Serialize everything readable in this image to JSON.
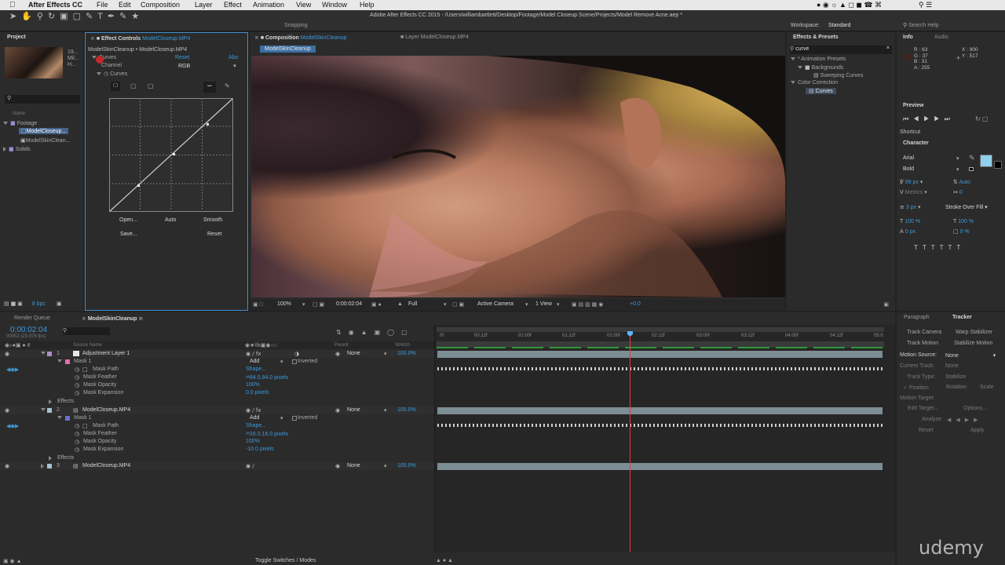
{
  "menubar": {
    "app": "After Effects CC",
    "items": [
      "File",
      "Edit",
      "Composition",
      "Layer",
      "Effect",
      "Animation",
      "View",
      "Window",
      "Help"
    ]
  },
  "window_title": "Adobe After Effects CC 2015 - /Users/williambartlett/Desktop/Footage/Model Closeup Scene/Projects/Model Remove Acne.aep *",
  "toolbar": {
    "snapping": "Snapping",
    "workspace_label": "Workspace:",
    "workspace_value": "Standard",
    "search_help": "Search Help"
  },
  "project": {
    "tab": "Project",
    "thumb_lines": [
      "19...",
      "Mil...",
      "H..."
    ],
    "column_name": "Name",
    "items": [
      {
        "name": "Footage",
        "kind": "folder"
      },
      {
        "name": "ModelCloseup...",
        "kind": "file",
        "selected": true
      },
      {
        "name": "ModelSkinClean...",
        "kind": "comp"
      },
      {
        "name": "Solids",
        "kind": "folder"
      }
    ],
    "bpc": "8 bpc"
  },
  "effect_controls": {
    "tab_prefix": "Effect Controls",
    "tab_layer": "ModelCloseup.MP4",
    "breadcrumb": "ModelSkinCleanup • ModelCloseup.MP4",
    "effect_name": "Curves",
    "reset": "Reset",
    "about": "Abo",
    "channel_label": "Channel",
    "channel_value": "RGB",
    "curves_label": "Curves",
    "open": "Open...",
    "auto": "Auto",
    "smooth": "Smooth",
    "save": "Save...",
    "reset2": "Reset"
  },
  "composition": {
    "tab_prefix": "Composition",
    "tab_comp": "ModelSkinCleanup",
    "layer_tab": "Layer ModelCloseup.MP4",
    "chip": "ModelSkinCleanup",
    "zoom": "100%",
    "timecode": "0:00:02:04",
    "quality": "Full",
    "camera": "Active Camera",
    "view": "1 View",
    "exposure": "+0.0"
  },
  "effects_presets": {
    "tab": "Effects & Presets",
    "search": "curve",
    "tree": [
      {
        "label": "* Animation Presets",
        "level": 0,
        "open": true
      },
      {
        "label": "Backgrounds",
        "level": 1,
        "open": true
      },
      {
        "label": "Sweeping Curves",
        "level": 2
      },
      {
        "label": "Color Correction",
        "level": 0,
        "open": true
      },
      {
        "label": "Curves",
        "level": 1,
        "selected": true
      }
    ]
  },
  "info": {
    "tab": "Info",
    "tab2": "Audio",
    "r": "R : 63",
    "g": "G : 37",
    "b": "B : 31",
    "a": "A : 255",
    "x": "X : 900",
    "y": "Y : 517"
  },
  "preview": {
    "tab": "Preview",
    "shortcut": "Shortcut"
  },
  "character": {
    "tab": "Character",
    "font": "Arial",
    "style": "Bold",
    "size": "99 px",
    "leading": "Auto",
    "kerning": "Metrics",
    "tracking": "0",
    "stroke": "3 px",
    "stroke_mode": "Stroke Over Fill",
    "vscale": "100 %",
    "hscale": "100 %",
    "baseline": "0 px",
    "tsume": "0 %",
    "fill_color": "#8fd0ea"
  },
  "timeline": {
    "render_queue": "Render Queue",
    "comp_tab": "ModelSkinCleanup",
    "timecode": "0:00:02:04",
    "frames": "00052 (23.976 fps)",
    "col_source": "Source Name",
    "col_parent": "Parent",
    "col_stretch": "Stretch",
    "ruler": [
      "0f",
      "00:12f",
      "01:00f",
      "01:12f",
      "02:00f",
      "02:12f",
      "03:00f",
      "03:12f",
      "04:00f",
      "04:12f",
      "05:0"
    ],
    "toggle": "Toggle Switches / Modes",
    "rows": [
      {
        "num": "1",
        "name": "Adjustment Layer 1",
        "level": 0,
        "parent": "None",
        "stretch": "100.0%"
      },
      {
        "name": "Mask 1",
        "level": 1,
        "mode": "Add",
        "inverted": "Inverted"
      },
      {
        "name": "Mask Path",
        "level": 2,
        "value": "Shape..."
      },
      {
        "name": "Mask Feather",
        "level": 2,
        "value": "84.0,84.0 pixels"
      },
      {
        "name": "Mask Opacity",
        "level": 2,
        "value": "100%"
      },
      {
        "name": "Mask Expansion",
        "level": 2,
        "value": "0.0 pixels"
      },
      {
        "name": "Effects",
        "level": 1
      },
      {
        "num": "2",
        "name": "ModelCloseup.MP4",
        "level": 0,
        "parent": "None",
        "stretch": "100.0%"
      },
      {
        "name": "Mask 1",
        "level": 1,
        "mode": "Add",
        "inverted": "Inverted"
      },
      {
        "name": "Mask Path",
        "level": 2,
        "value": "Shape..."
      },
      {
        "name": "Mask Feather",
        "level": 2,
        "value": "16.0,16.0 pixels"
      },
      {
        "name": "Mask Opacity",
        "level": 2,
        "value": "100%"
      },
      {
        "name": "Mask Expansion",
        "level": 2,
        "value": "-10.0 pixels"
      },
      {
        "name": "Effects",
        "level": 1
      },
      {
        "num": "3",
        "name": "ModelCloseup.MP4",
        "level": 0,
        "parent": "None",
        "stretch": "100.0%"
      }
    ]
  },
  "tracker": {
    "tab_paragraph": "Paragraph",
    "tab": "Tracker",
    "track_camera": "Track Camera",
    "warp_stabilizer": "Warp Stabilizer",
    "track_motion": "Track Motion",
    "stabilize_motion": "Stabilize Motion",
    "motion_source_label": "Motion Source:",
    "motion_source": "None",
    "current_track_label": "Current Track:",
    "current_track": "None",
    "track_type_label": "Track Type:",
    "track_type": "Stabilize",
    "position": "Position",
    "rotation": "Rotation",
    "scale": "Scale",
    "motion_target": "Motion Target:",
    "edit_target": "Edit Target...",
    "options": "Options...",
    "analyze": "Analyze:",
    "reset": "Reset",
    "apply": "Apply"
  },
  "watermark": "udemy"
}
